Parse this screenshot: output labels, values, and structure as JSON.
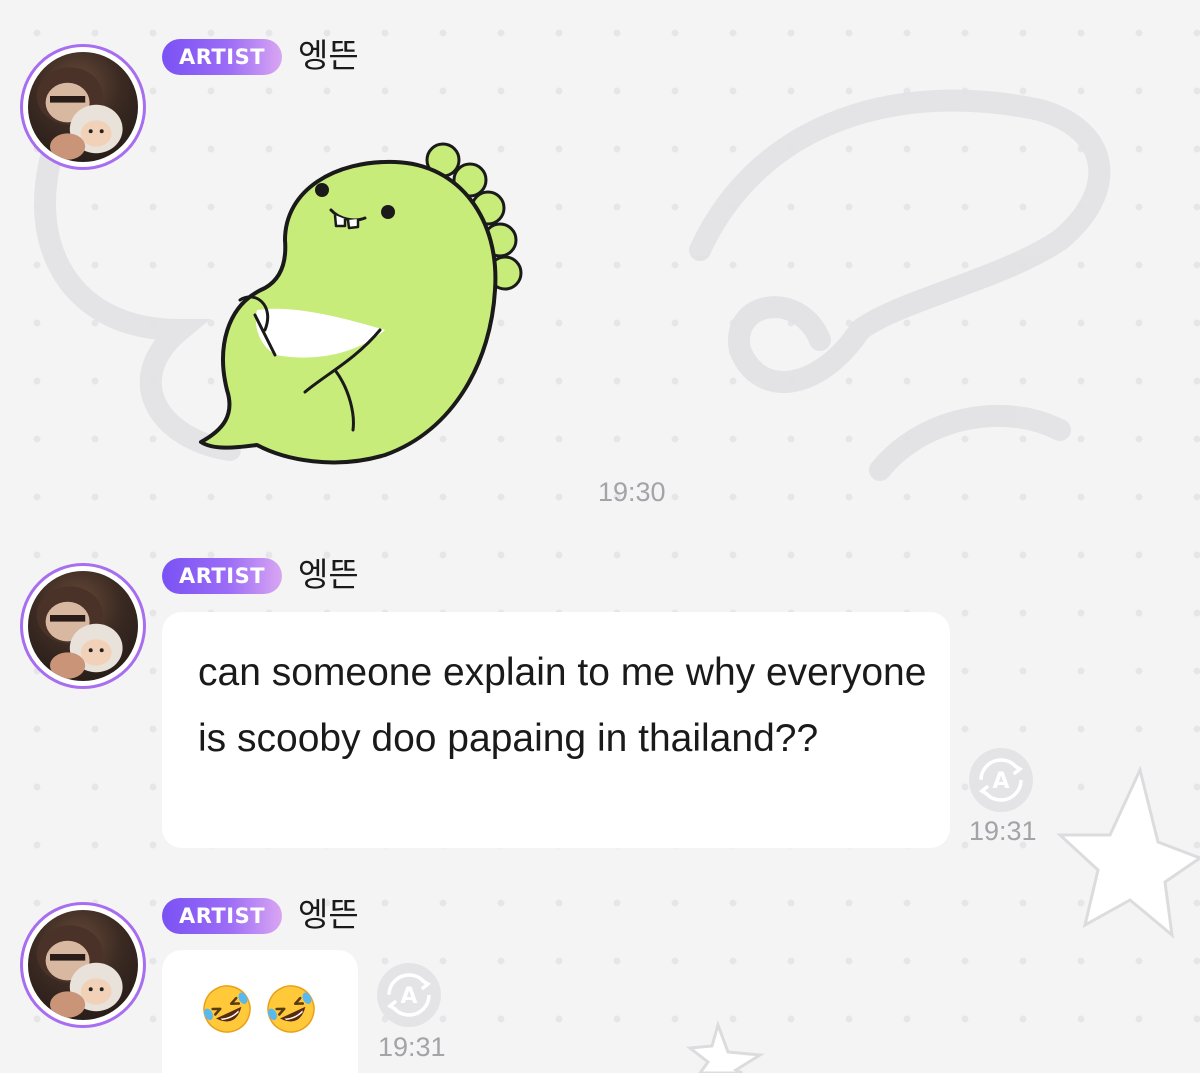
{
  "colors": {
    "accent": "#9b6cf6",
    "badge_start": "#7a52f4",
    "badge_end": "#d9a6f2",
    "sticker_green": "#c8ec7a",
    "timestamp": "#a3a3a8",
    "background": "#f4f4f5"
  },
  "messages": [
    {
      "badge": "ARTIST",
      "sender": "엥뜬",
      "type": "sticker",
      "sticker_icon": "green-dinosaur-sticker",
      "time": "19:30"
    },
    {
      "badge": "ARTIST",
      "sender": "엥뜬",
      "type": "text",
      "text": "can someone explain to me why everyone is scooby doo papaing in thailand??",
      "translate_icon": "translate-icon",
      "time": "19:31"
    },
    {
      "badge": "ARTIST",
      "sender": "엥뜬",
      "type": "emoji",
      "emojis": [
        "rolling-on-floor-laughing-emoji",
        "rolling-on-floor-laughing-emoji"
      ],
      "translate_icon": "translate-icon",
      "time": "19:31"
    }
  ]
}
